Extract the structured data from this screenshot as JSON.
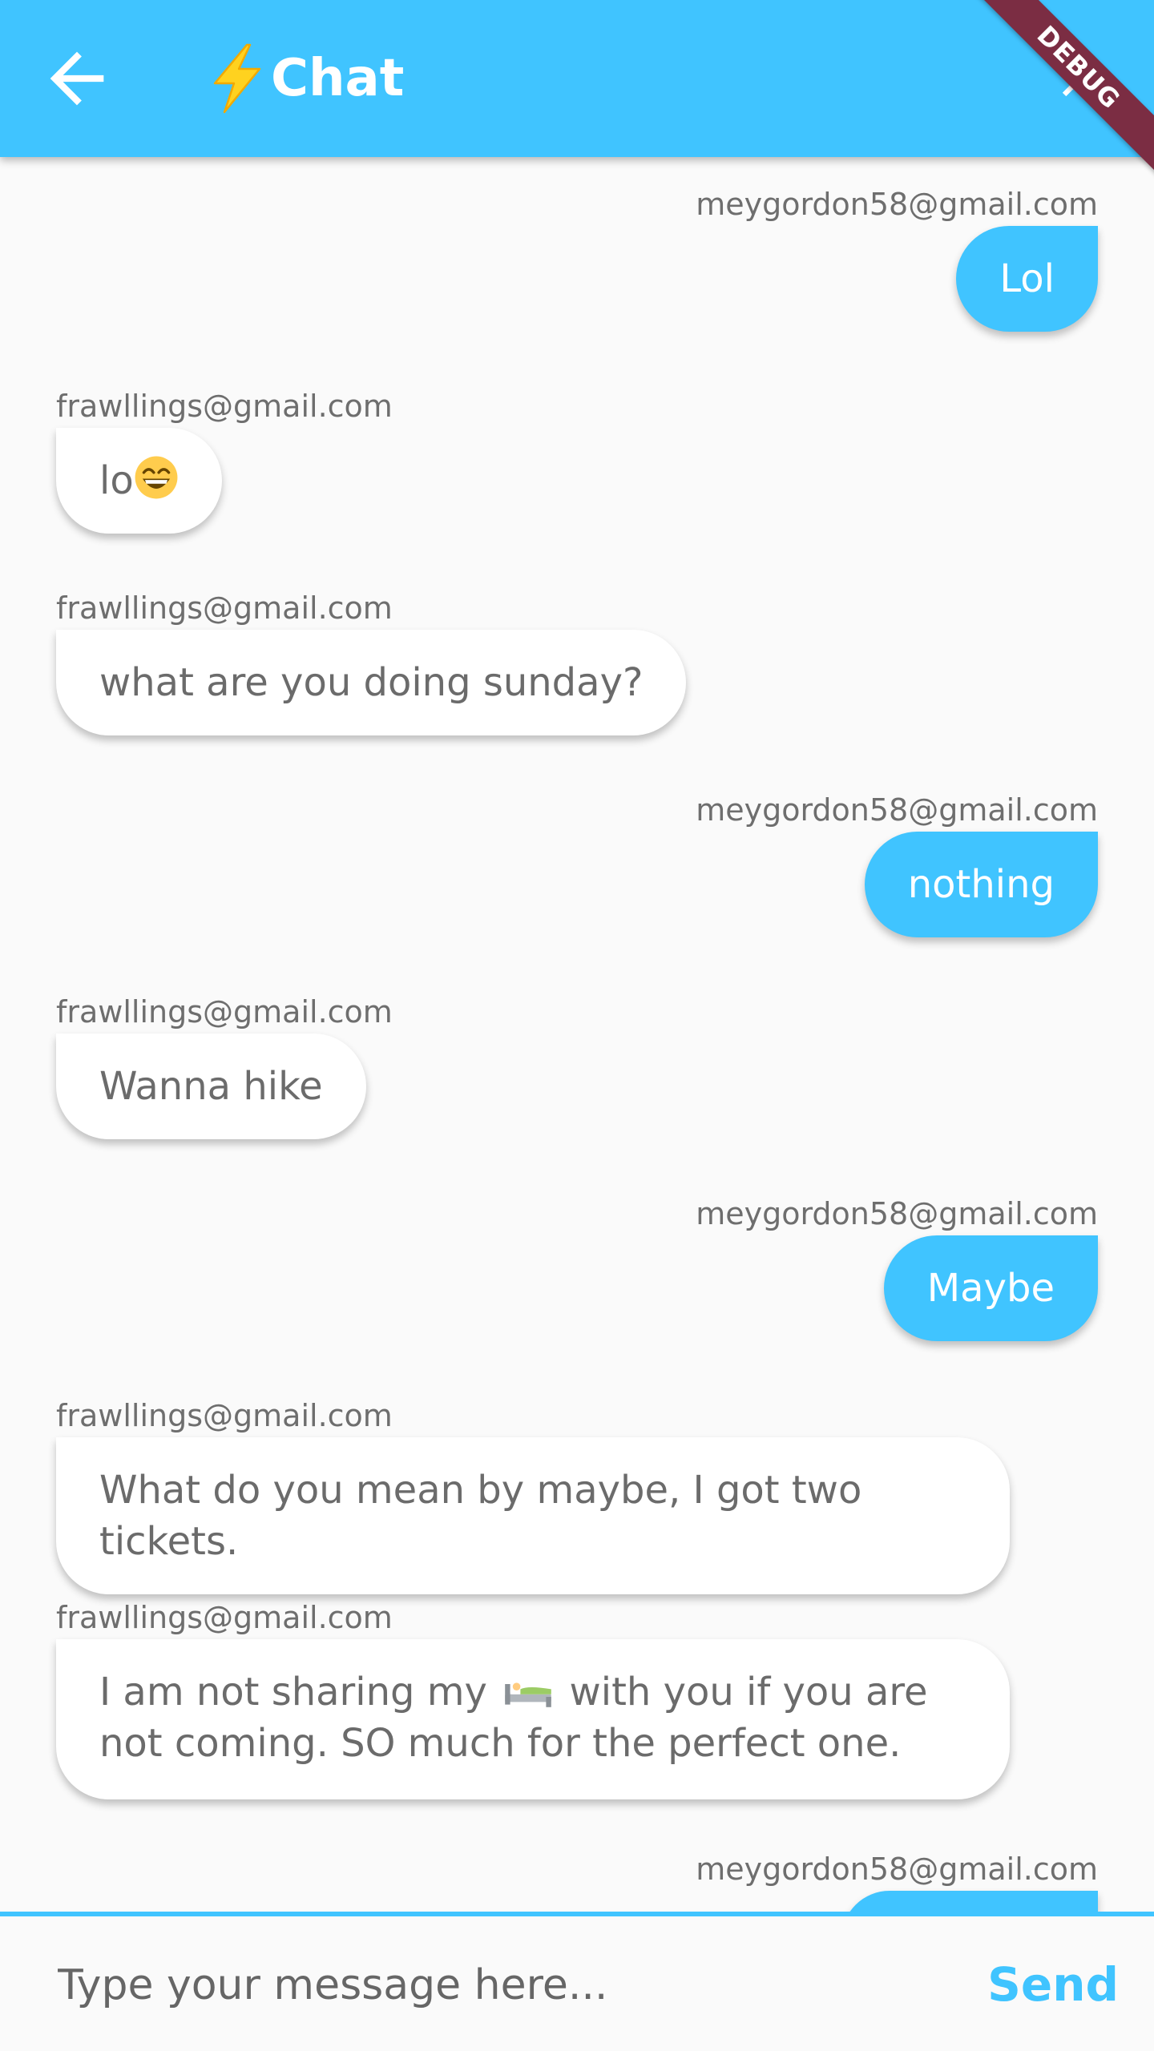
{
  "appbar": {
    "title": "Chat",
    "title_icon": "lightning-bolt-icon",
    "back_icon": "arrow-back-icon",
    "close_icon": "close-icon",
    "background": "#40c4ff",
    "debug_label": "DEBUG"
  },
  "messages": [
    {
      "sender": "meygordon58@gmail.com",
      "text": "Lol",
      "is_me": true
    },
    {
      "sender": "frawllings@gmail.com",
      "text": "lo",
      "emoji": "grinning-face",
      "is_me": false
    },
    {
      "sender": "frawllings@gmail.com",
      "text": "what are you doing sunday?",
      "is_me": false
    },
    {
      "sender": "meygordon58@gmail.com",
      "text": "nothing",
      "is_me": true
    },
    {
      "sender": "frawllings@gmail.com",
      "text": "Wanna hike",
      "is_me": false
    },
    {
      "sender": "meygordon58@gmail.com",
      "text": "Maybe",
      "is_me": true
    },
    {
      "sender": "frawllings@gmail.com",
      "text": "What do you mean by maybe, I got two tickets.",
      "is_me": false
    },
    {
      "sender": "frawllings@gmail.com",
      "text_before": "I am not sharing my",
      "emoji": "bed",
      "text_after": "with you if you are not coming. SO much for the perfect one.",
      "is_me": false
    },
    {
      "sender": "meygordon58@gmail.com",
      "text": "",
      "is_me": true
    }
  ],
  "composer": {
    "placeholder": "Type your message here...",
    "send_label": "Send",
    "accent": "#40c4ff"
  }
}
